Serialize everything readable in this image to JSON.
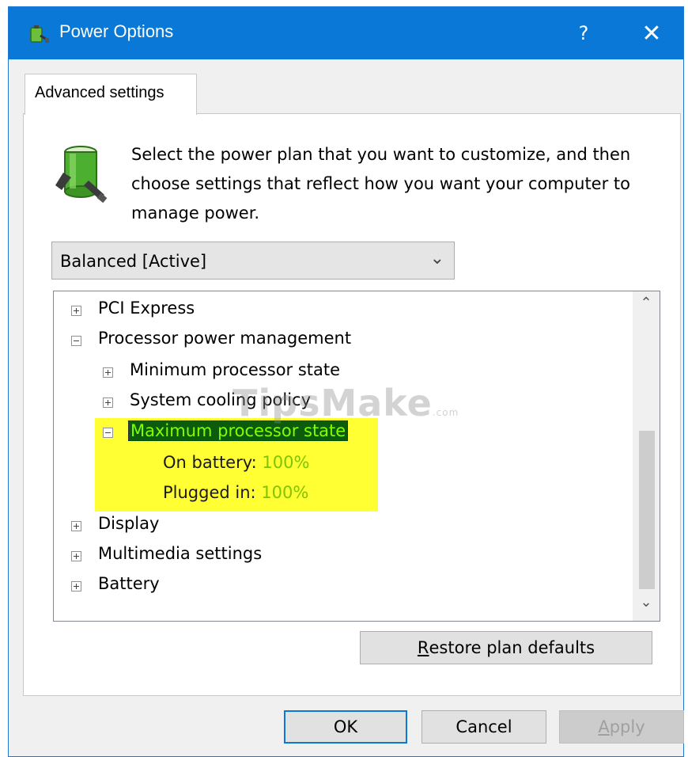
{
  "window": {
    "title": "Power Options",
    "help_label": "?",
    "close_label": "✕",
    "title_icon": "power-options-icon",
    "accent_color": "#0a78d7"
  },
  "tab": {
    "label": "Advanced settings"
  },
  "description": "Select the power plan that you want to customize, and then choose settings that reflect how you want your computer to manage power.",
  "plan_select": {
    "value": "Balanced [Active]",
    "chevron": "⌄"
  },
  "tree": {
    "items": [
      {
        "label": "PCI Express",
        "expanded": false
      },
      {
        "label": "Processor power management",
        "expanded": true
      },
      {
        "label": "Minimum processor state",
        "expanded": false
      },
      {
        "label": "System cooling policy",
        "expanded": false
      },
      {
        "label": "Maximum processor state",
        "expanded": true,
        "selected": true
      },
      {
        "label": "Display",
        "expanded": false
      },
      {
        "label": "Multimedia settings",
        "expanded": false
      },
      {
        "label": "Battery",
        "expanded": false
      }
    ],
    "max_state": {
      "on_battery_label": "On battery:",
      "on_battery_value": "100%",
      "plugged_in_label": "Plugged in:",
      "plugged_in_value": "100%"
    },
    "highlight_color": "#ffff33",
    "scroll_up": "⌃",
    "scroll_down": "⌄"
  },
  "watermark": {
    "brand": "TipsMake",
    "suffix": ".com"
  },
  "buttons": {
    "restore_mnemonic": "R",
    "restore_rest": "estore plan defaults",
    "ok": "OK",
    "cancel": "Cancel",
    "apply_mnemonic": "A",
    "apply_rest": "pply"
  }
}
